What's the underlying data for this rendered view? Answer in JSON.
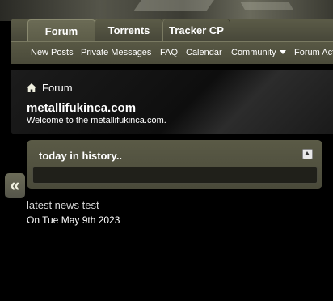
{
  "navbar": {
    "tabs": [
      "Forum",
      "Torrents",
      "Tracker CP"
    ],
    "active_tab": "Forum"
  },
  "subnav": {
    "items": [
      "New Posts",
      "Private Messages",
      "FAQ",
      "Calendar",
      "Community",
      "Forum Act"
    ]
  },
  "breadcrumb": {
    "home_label": "Forum"
  },
  "site": {
    "name": "metallifukinca.com",
    "welcome": "Welcome to the metallifukinca.com."
  },
  "sidebar_toggle": {
    "glyph": "«"
  },
  "history_box": {
    "title": "today in history.."
  },
  "news": {
    "title": "latest news test",
    "date": "On Tue May 9th 2023"
  }
}
